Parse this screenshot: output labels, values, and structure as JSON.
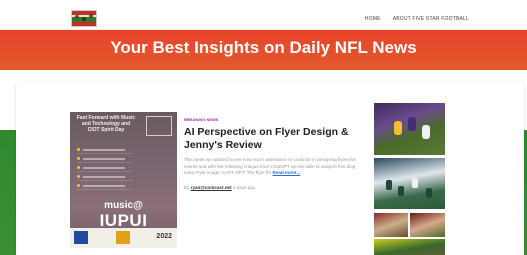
{
  "header": {
    "nav": [
      {
        "label": "HOME"
      },
      {
        "label": "ABOUT FIVE STAR FOOTBALL"
      }
    ]
  },
  "hero": {
    "title": "Your Best Insights on Daily NFL News"
  },
  "post": {
    "category": "BREAKING NEWS",
    "title": "AI Perspective on Flyer Design & Jenny's Review",
    "excerpt": "This week we wanted to see how much assistance AI could be in designing flyers for events and with the following critique from ChatGPT we are able to analyze this blog meta Flyer image: CHTF DPT: The flyer for",
    "read_more": "Read more...",
    "meta_prefix": "By",
    "author": "ryan@comcast.net",
    "time": "4 days ago"
  },
  "flyer": {
    "heading": "Fast Forward with Music and Technology and CIOT Spirit Day",
    "music_text": "music@",
    "school_text": "IUPUI",
    "year": "2022"
  },
  "colors": {
    "hero_red": "#e8432a",
    "field_green": "#2f8a2f",
    "category": "#9a2f9a",
    "link": "#2b6cd9"
  }
}
